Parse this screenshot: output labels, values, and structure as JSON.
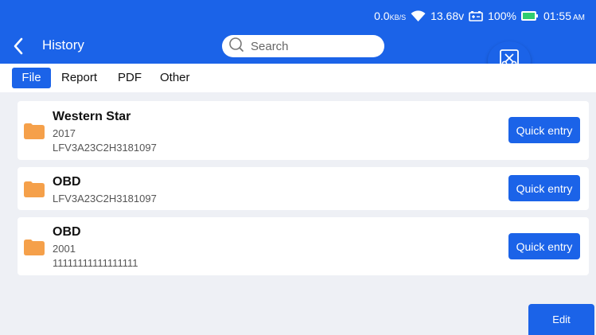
{
  "status_bar": {
    "speed": "0.0",
    "speed_unit": "KB/S",
    "voltage": "13.68v",
    "battery": "100%",
    "time": "01:55",
    "ampm": "AM"
  },
  "header": {
    "title": "History",
    "search_placeholder": "Search"
  },
  "tabs": [
    {
      "label": "File",
      "active": true
    },
    {
      "label": "Report"
    },
    {
      "label": "PDF"
    },
    {
      "label": "Other"
    }
  ],
  "records": [
    {
      "name": "Western Star",
      "year": "2017",
      "vin": "LFV3A23C2H3181097",
      "button": "Quick entry"
    },
    {
      "name": "OBD",
      "vin": "LFV3A23C2H3181097",
      "button": "Quick entry"
    },
    {
      "name": "OBD",
      "year": "2001",
      "vin": "11111111111111111",
      "button": "Quick entry"
    }
  ],
  "edit_label": "Edit",
  "colors": {
    "primary": "#1b63e8",
    "folder": "#f5a04a",
    "background": "#eef0f5"
  },
  "icons": [
    "back-arrow-icon",
    "search-icon",
    "wifi-icon",
    "car-battery-icon",
    "battery-icon",
    "disconnect-icon",
    "folder-icon"
  ]
}
